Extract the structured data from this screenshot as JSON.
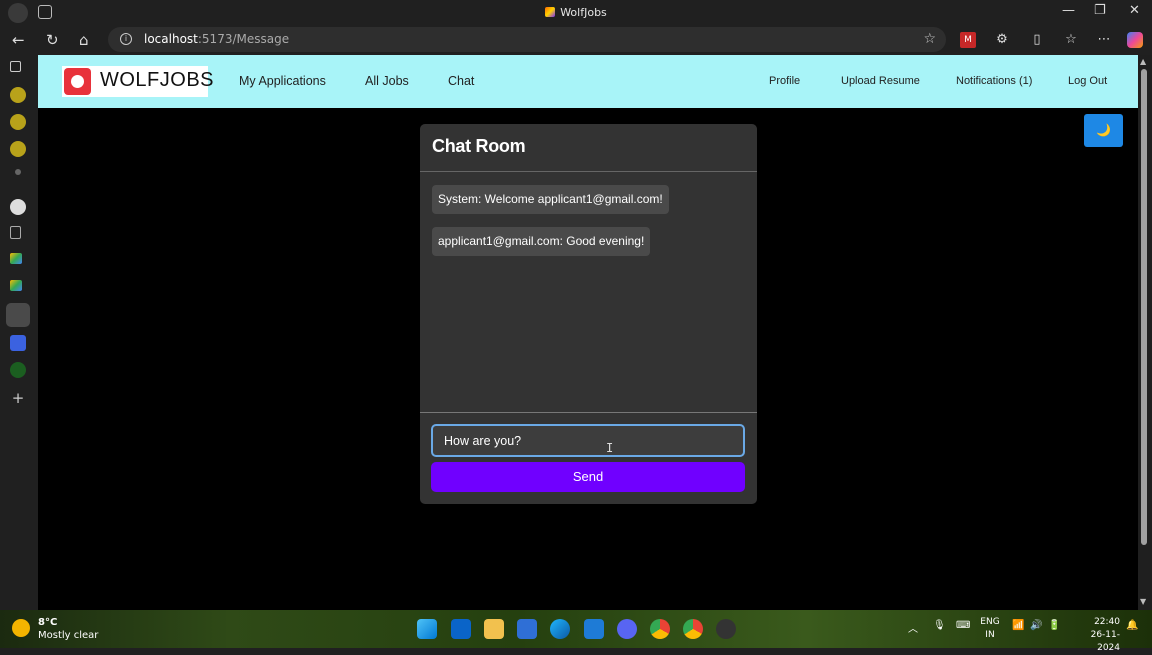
{
  "browser": {
    "window_title": "WolfJobs",
    "url_host": "localhost",
    "url_path": ":5173/Message"
  },
  "app": {
    "brand": "WOLFJOBS",
    "nav_left": [
      "My Applications",
      "All Jobs",
      "Chat"
    ],
    "nav_right": [
      "Profile",
      "Upload Resume",
      "Notifications (1)",
      "Log Out"
    ],
    "theme_toggle_icon": "moon-icon"
  },
  "chat": {
    "title": "Chat Room",
    "messages": [
      "System: Welcome applicant1@gmail.com!",
      "applicant1@gmail.com: Good evening!"
    ],
    "input_value": "How are you?",
    "send_label": "Send"
  },
  "taskbar": {
    "temperature": "8°C",
    "weather": "Mostly clear",
    "lang_top": "ENG",
    "lang_bottom": "IN",
    "time": "22:40",
    "date": "26-11-2024"
  },
  "colors": {
    "nav_bg": "#a8f4f8",
    "send_button": "#7000ff",
    "theme_button": "#1e88e5",
    "brand_red": "#e8323b"
  }
}
